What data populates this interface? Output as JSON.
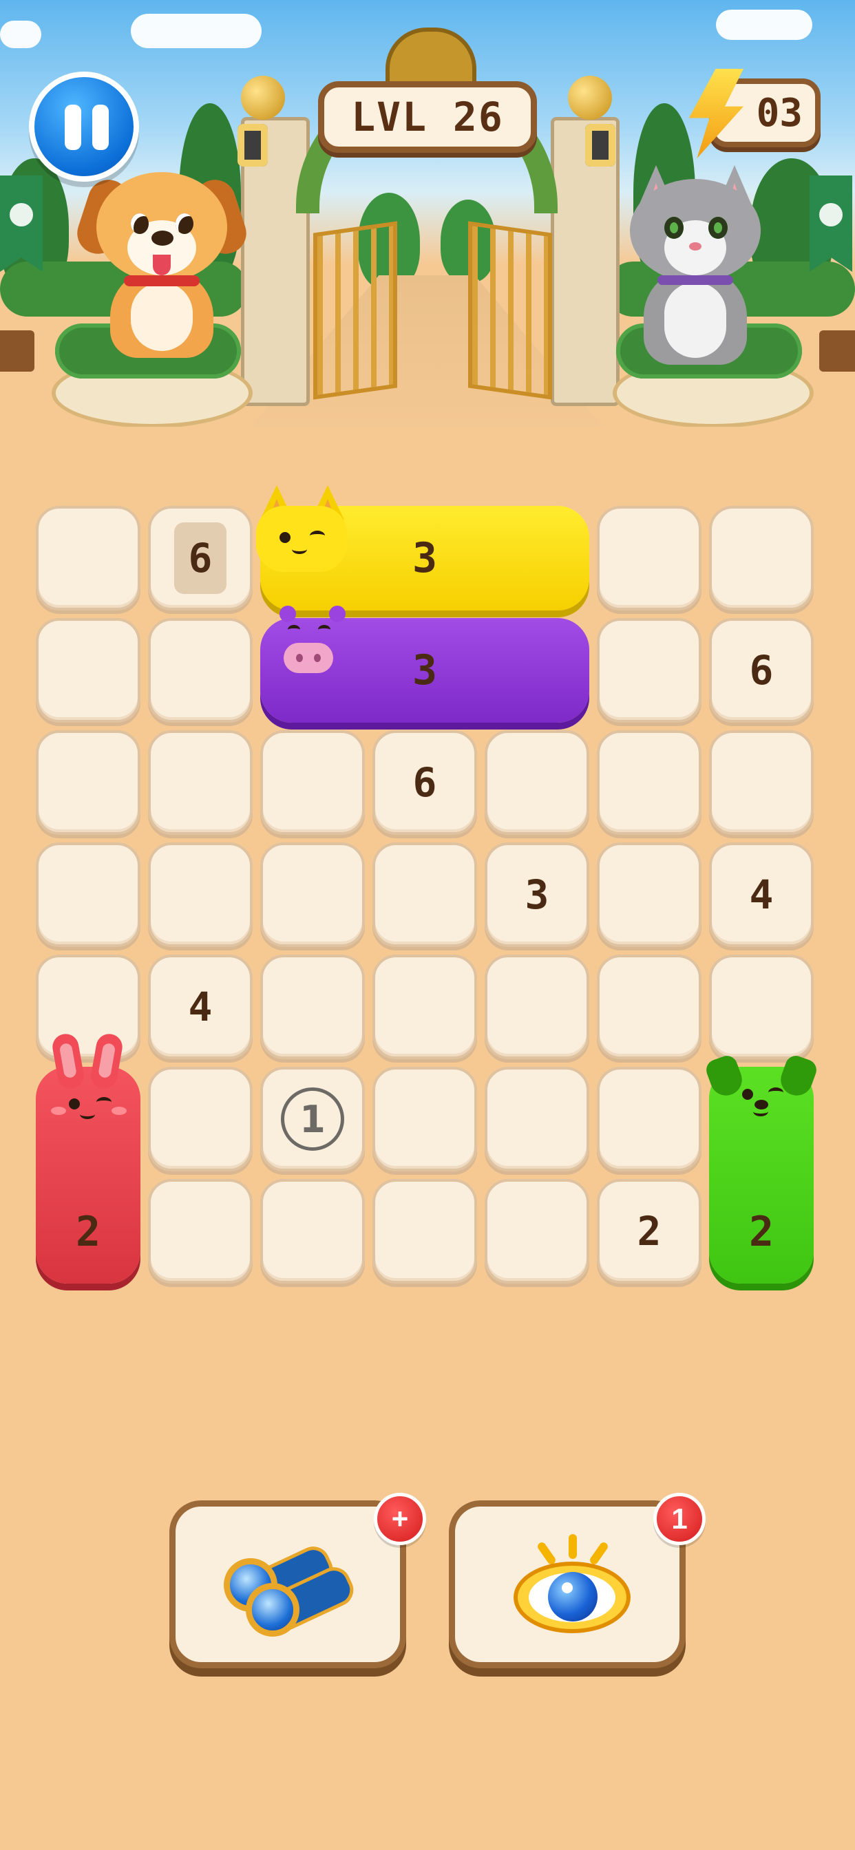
{
  "hud": {
    "level_label": "LVL 26",
    "energy_count": "03",
    "pause_icon": "pause-icon",
    "energy_icon": "lightning-bolt-icon"
  },
  "board": {
    "rows": 7,
    "cols": 7,
    "cells": [
      {
        "row": 0,
        "col": 0,
        "value": ""
      },
      {
        "row": 0,
        "col": 1,
        "value": "6",
        "style": "locked"
      },
      {
        "row": 0,
        "col": 5,
        "value": ""
      },
      {
        "row": 0,
        "col": 6,
        "value": ""
      },
      {
        "row": 1,
        "col": 0,
        "value": ""
      },
      {
        "row": 1,
        "col": 1,
        "value": ""
      },
      {
        "row": 1,
        "col": 5,
        "value": ""
      },
      {
        "row": 1,
        "col": 6,
        "value": "6"
      },
      {
        "row": 2,
        "col": 0,
        "value": ""
      },
      {
        "row": 2,
        "col": 1,
        "value": ""
      },
      {
        "row": 2,
        "col": 2,
        "value": ""
      },
      {
        "row": 2,
        "col": 3,
        "value": "6"
      },
      {
        "row": 2,
        "col": 4,
        "value": ""
      },
      {
        "row": 2,
        "col": 5,
        "value": ""
      },
      {
        "row": 2,
        "col": 6,
        "value": ""
      },
      {
        "row": 3,
        "col": 0,
        "value": ""
      },
      {
        "row": 3,
        "col": 1,
        "value": ""
      },
      {
        "row": 3,
        "col": 2,
        "value": ""
      },
      {
        "row": 3,
        "col": 3,
        "value": ""
      },
      {
        "row": 3,
        "col": 4,
        "value": "3"
      },
      {
        "row": 3,
        "col": 5,
        "value": ""
      },
      {
        "row": 3,
        "col": 6,
        "value": "4"
      },
      {
        "row": 4,
        "col": 0,
        "value": ""
      },
      {
        "row": 4,
        "col": 1,
        "value": "4"
      },
      {
        "row": 4,
        "col": 2,
        "value": ""
      },
      {
        "row": 4,
        "col": 3,
        "value": ""
      },
      {
        "row": 4,
        "col": 4,
        "value": ""
      },
      {
        "row": 4,
        "col": 5,
        "value": ""
      },
      {
        "row": 4,
        "col": 6,
        "value": ""
      },
      {
        "row": 5,
        "col": 1,
        "value": ""
      },
      {
        "row": 5,
        "col": 2,
        "value": "1",
        "style": "circled"
      },
      {
        "row": 5,
        "col": 3,
        "value": ""
      },
      {
        "row": 5,
        "col": 4,
        "value": ""
      },
      {
        "row": 5,
        "col": 5,
        "value": ""
      },
      {
        "row": 6,
        "col": 1,
        "value": ""
      },
      {
        "row": 6,
        "col": 2,
        "value": ""
      },
      {
        "row": 6,
        "col": 3,
        "value": ""
      },
      {
        "row": 6,
        "col": 4,
        "value": ""
      },
      {
        "row": 6,
        "col": 5,
        "value": "2"
      }
    ]
  },
  "pieces": [
    {
      "animal": "cat",
      "color": "#f6cf00",
      "row": 0,
      "col": 2,
      "length": 3,
      "orientation": "horizontal",
      "value": "3"
    },
    {
      "animal": "pig",
      "color": "#7e2ac9",
      "row": 1,
      "col": 2,
      "length": 3,
      "orientation": "horizontal",
      "value": "3"
    },
    {
      "animal": "bunny",
      "color": "#d93540",
      "row": 5,
      "col": 0,
      "length": 2,
      "orientation": "vertical",
      "value": "2"
    },
    {
      "animal": "dog",
      "color": "#3fc612",
      "row": 5,
      "col": 6,
      "length": 2,
      "orientation": "vertical",
      "value": "2"
    }
  ],
  "boosters": [
    {
      "name": "binoculars",
      "icon": "binoculars-icon",
      "badge": "+"
    },
    {
      "name": "eye",
      "icon": "eye-icon",
      "badge": "1"
    }
  ]
}
